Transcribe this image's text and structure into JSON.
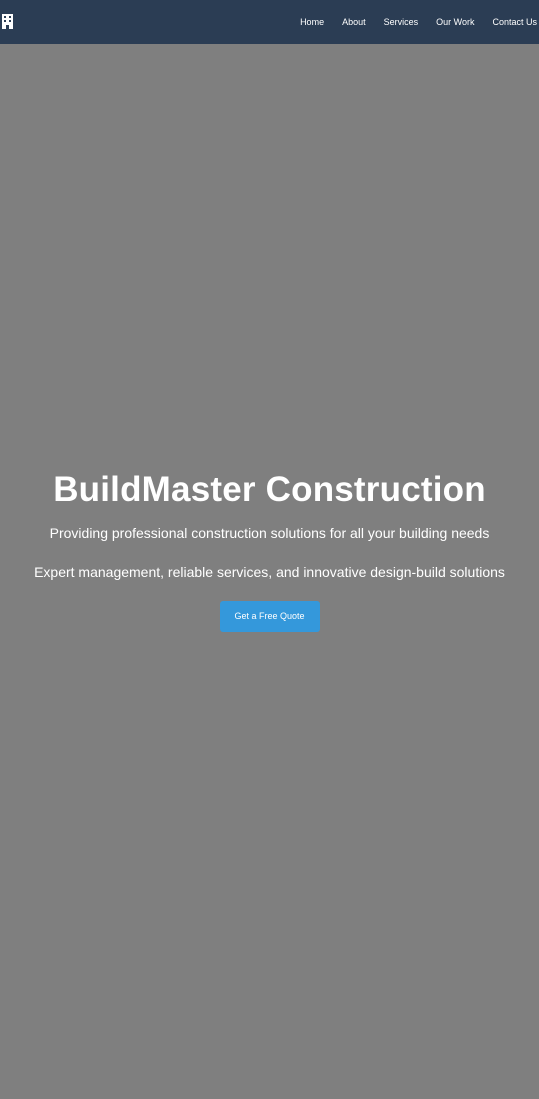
{
  "navbar": {
    "logo_icon": "building-icon",
    "links": [
      {
        "label": "Home"
      },
      {
        "label": "About"
      },
      {
        "label": "Services"
      },
      {
        "label": "Our Work"
      },
      {
        "label": "Contact Us"
      }
    ]
  },
  "hero": {
    "title": "BuildMaster Construction",
    "subtitle": "Providing professional construction solutions for all your building needs",
    "description": "Expert management, reliable services, and innovative design-build solutions",
    "cta_label": "Get a Free Quote"
  },
  "colors": {
    "navbar_background": "#2b3d54",
    "hero_background": "#7f7f7f",
    "button_background": "#3498db",
    "text": "#ffffff"
  }
}
